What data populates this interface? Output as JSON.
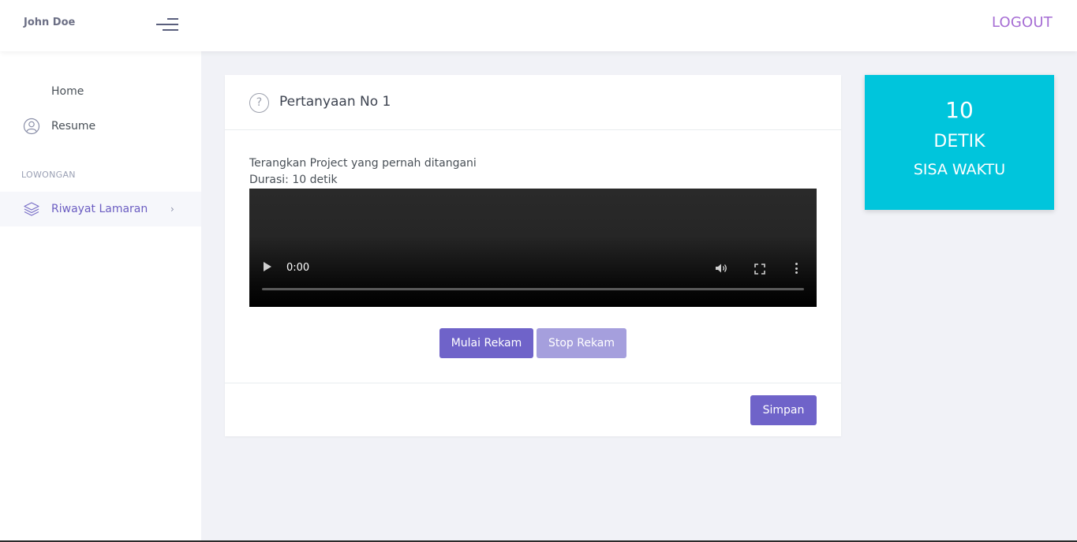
{
  "header": {
    "user_name": "John Doe",
    "logout_label": "LOGOUT"
  },
  "sidebar": {
    "items": [
      {
        "label": "Home",
        "icon": "home-icon"
      },
      {
        "label": "Resume",
        "icon": "user-circle-icon"
      }
    ],
    "section_label": "LOWONGAN",
    "section_items": [
      {
        "label": "Riwayat Lamaran",
        "icon": "layers-icon",
        "chevron": "›"
      }
    ]
  },
  "question_card": {
    "title": "Pertanyaan No 1",
    "question_text": "Terangkan Project yang pernah ditangani",
    "duration_text": "Durasi: 10 detik",
    "video": {
      "current_time": "0:00",
      "progress": 0
    },
    "start_record_label": "Mulai Rekam",
    "stop_record_label": "Stop Rekam",
    "save_label": "Simpan"
  },
  "timer": {
    "value": "10",
    "unit": "DETIK",
    "label": "SISA WAKTU"
  },
  "colors": {
    "accent": "#6f63c9",
    "accent_light": "#a59fdd",
    "timer_bg": "#00c5dc",
    "logout": "#a66dd4"
  }
}
